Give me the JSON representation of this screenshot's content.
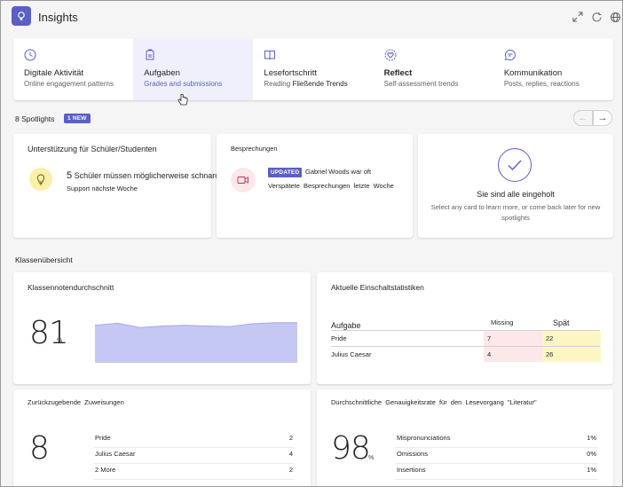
{
  "app": {
    "title": "Insights"
  },
  "header_icons": [
    "expand-icon",
    "refresh-icon",
    "globe-icon"
  ],
  "tabs": [
    {
      "label": "Digitale Aktivität",
      "sub": "Online engagement patterns",
      "icon": "clock-icon",
      "active": false
    },
    {
      "label": "Aufgaben",
      "sub": "Grades and submissions",
      "icon": "assignment-icon",
      "active": true
    },
    {
      "label": "Lesefortschritt",
      "sub_prefix": "Reading ",
      "sub_bold": "Fließende Trends",
      "icon": "book-icon",
      "active": false
    },
    {
      "label": "Reflect",
      "sub": "Self-assessment trends",
      "icon": "heart-circle-icon",
      "active": false
    },
    {
      "label": "Kommunikation",
      "sub": "Posts, replies, reactions",
      "icon": "chat-icon",
      "active": false
    }
  ],
  "spotlights": {
    "count_label": "8 Spotlights",
    "new_badge": "1 NEW",
    "cards": {
      "support": {
        "title": "Unterstützung für Schüler/Studenten",
        "count": "5",
        "line1": "Schüler müssen möglicherweise schnarchen",
        "line2": "Support nächste Woche"
      },
      "meetings": {
        "title": "Besprechungen",
        "badge": "UPDATED",
        "line1": "Gabriel Woods war oft",
        "line2": "Verspätete Besprechungen letzte Woche"
      },
      "caught_up": {
        "title": "Sie sind alle eingeholt",
        "sub": "Select any card to learn more, or come back later for new spotlights"
      }
    }
  },
  "overview": {
    "title": "Klassenübersicht",
    "grade_avg": {
      "title": "Klassennotendurchschnitt",
      "value": "81",
      "unit": "%",
      "trend": [
        68,
        72,
        64,
        67,
        68,
        67,
        66,
        71,
        73,
        73
      ]
    },
    "stats": {
      "title": "Aktuelle Einschaltstatistiken",
      "col_task": "Aufgabe",
      "col_missing": "Missing",
      "col_late": "Spät",
      "rows": [
        {
          "name": "Pride",
          "missing": "7",
          "late": "22"
        },
        {
          "name": "Julius Caesar",
          "missing": "4",
          "late": "26"
        }
      ]
    },
    "returns": {
      "title": "Zurückzugebende Zuweisungen",
      "value": "8",
      "items": [
        {
          "name": "Pride",
          "value": "2"
        },
        {
          "name": "Julius Caesar",
          "value": "4"
        },
        {
          "name": "2 More",
          "value": "2"
        }
      ]
    },
    "accuracy": {
      "title": "Durchschnittliche Genauigkeitsrate für den Lesevorgang \"Literatur\"",
      "value": "98",
      "unit": "%",
      "items": [
        {
          "name": "Mispronunciations",
          "value": "1%"
        },
        {
          "name": "Omissions",
          "value": "0%"
        },
        {
          "name": "Insertions",
          "value": "1%"
        }
      ]
    }
  },
  "colors": {
    "accent": "#5b5fc7",
    "chart_fill": "#c5c8f2",
    "chart_line": "#a5a9ea",
    "missing_bg": "#fde7e9",
    "late_bg": "#fdf6c3"
  }
}
